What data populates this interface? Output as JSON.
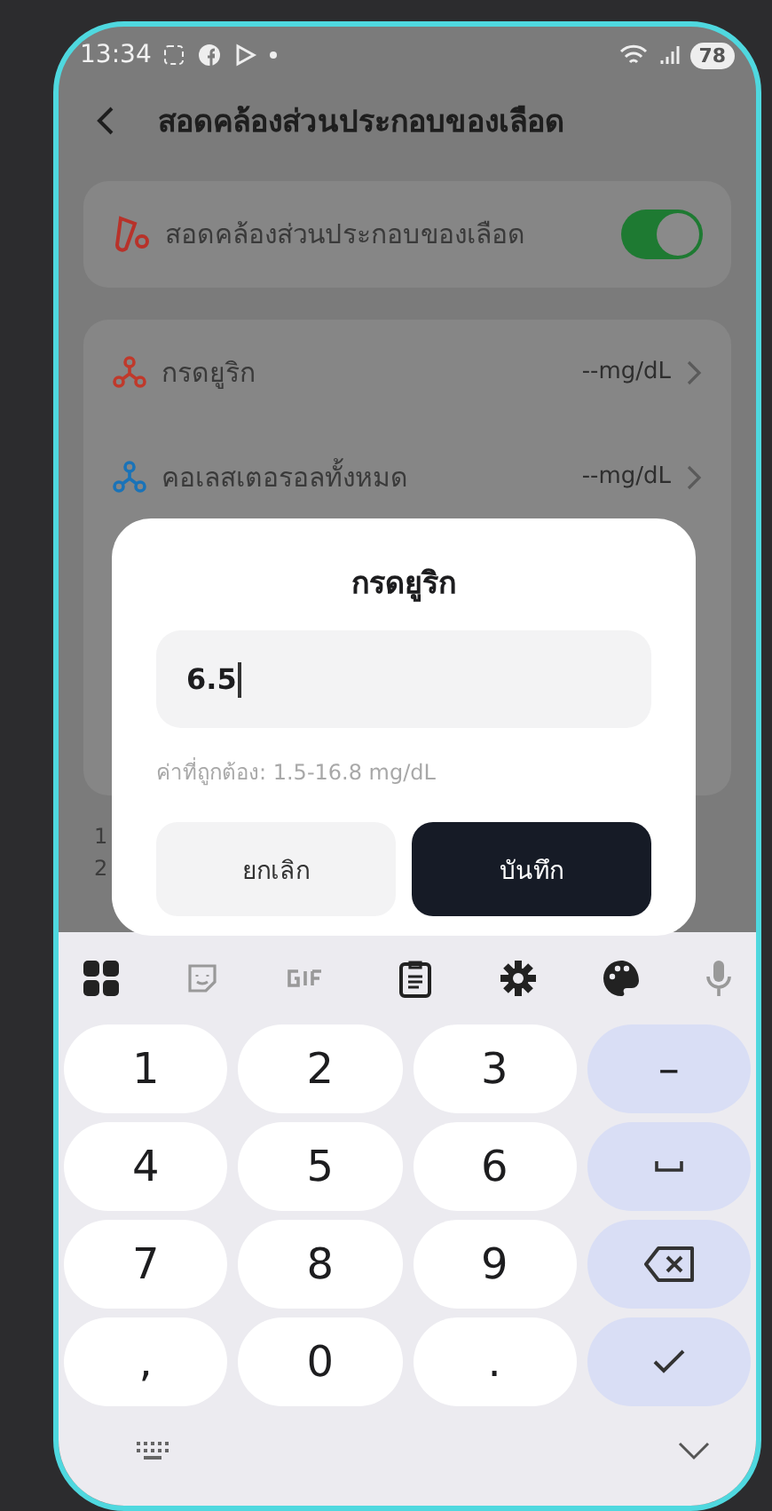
{
  "status_bar": {
    "time": "13:34",
    "battery": "78"
  },
  "header": {
    "title": "สอดคล้องส่วนประกอบของเลือด"
  },
  "master_toggle": {
    "label": "สอดคล้องส่วนประกอบของเลือด",
    "on": true
  },
  "metrics": [
    {
      "name": "กรดยูริก",
      "value": "--mg/dL",
      "color": "#c0392b"
    },
    {
      "name": "คอเลสเตอรอลทั้งหมด",
      "value": "--mg/dL",
      "color": "#1a73b8"
    }
  ],
  "behind_notes": [
    "1",
    "2"
  ],
  "dialog": {
    "title": "กรดยูริก",
    "value": "6.5",
    "hint": "ค่าที่ถูกต้อง: 1.5-16.8 mg/dL",
    "buttons": [
      {
        "label": "ยกเลิก",
        "primary": false
      },
      {
        "label": "บันทึก",
        "primary": true
      }
    ]
  },
  "keyboard": {
    "keys": [
      {
        "kind": "char",
        "label": "1"
      },
      {
        "kind": "char",
        "label": "2"
      },
      {
        "kind": "char",
        "label": "3"
      },
      {
        "kind": "action",
        "label": "–"
      },
      {
        "kind": "char",
        "label": "4"
      },
      {
        "kind": "char",
        "label": "5"
      },
      {
        "kind": "char",
        "label": "6"
      },
      {
        "kind": "space"
      },
      {
        "kind": "char",
        "label": "7"
      },
      {
        "kind": "char",
        "label": "8"
      },
      {
        "kind": "char",
        "label": "9"
      },
      {
        "kind": "backspace"
      },
      {
        "kind": "char",
        "label": ","
      },
      {
        "kind": "char",
        "label": "0"
      },
      {
        "kind": "char",
        "label": "."
      },
      {
        "kind": "enter"
      }
    ]
  }
}
